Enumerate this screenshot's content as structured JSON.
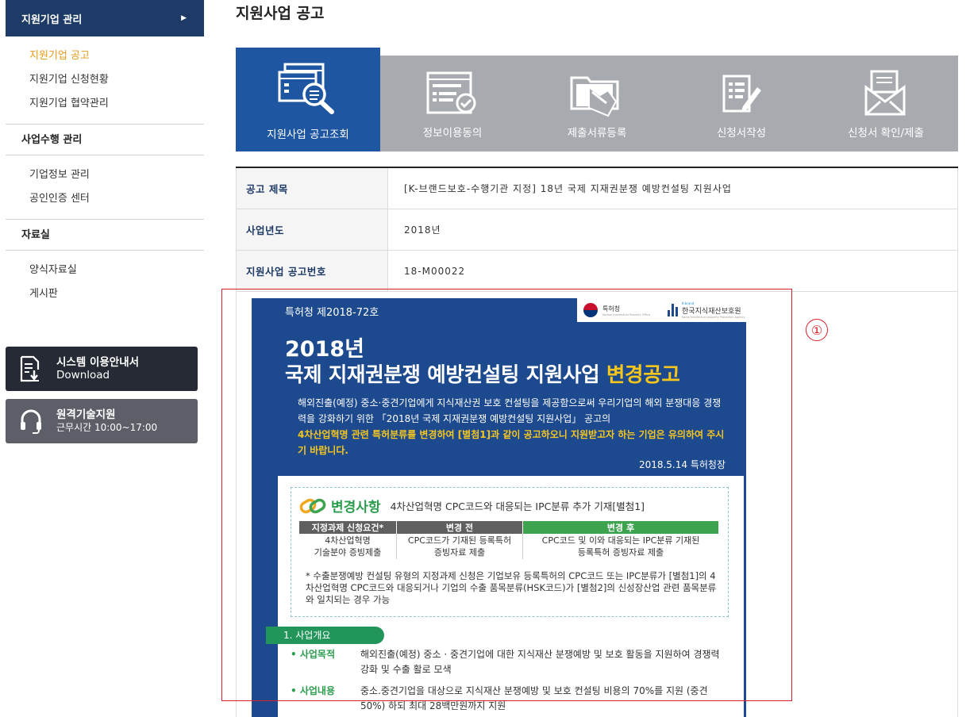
{
  "sidebar": {
    "head_label": "지원기업 관리",
    "sub_items": [
      {
        "label": "지원기업 공고",
        "active": true
      },
      {
        "label": "지원기업 신청현황",
        "active": false
      },
      {
        "label": "지원기업 협약관리",
        "active": false
      }
    ],
    "sections": [
      {
        "title": "사업수행 관리",
        "items": [
          "기업정보 관리",
          "공인인증 센터"
        ]
      },
      {
        "title": "자료실",
        "items": [
          "양식자료실",
          "게시판"
        ]
      }
    ],
    "download_btn": {
      "line1": "시스템 이용안내서",
      "line2": "Download"
    },
    "support_btn": {
      "line1": "원격기술지원",
      "line2": "근무시간 10:00~17:00"
    }
  },
  "page": {
    "title": "지원사업 공고"
  },
  "steps": [
    {
      "label": "지원사업 공고조회",
      "active": true,
      "icon": "search-document-icon"
    },
    {
      "label": "정보이용동의",
      "active": false,
      "icon": "checklist-icon"
    },
    {
      "label": "제출서류등록",
      "active": false,
      "icon": "document-upload-icon"
    },
    {
      "label": "신청서작성",
      "active": false,
      "icon": "write-form-icon"
    },
    {
      "label": "신청서 확인/제출",
      "active": false,
      "icon": "envelope-icon"
    }
  ],
  "info": [
    {
      "key": "공고 제목",
      "value": "[K-브랜드보호-수행기관 지정] 18년 국제 지재권분쟁 예방컨설팅 지원사업"
    },
    {
      "key": "사업년도",
      "value": "2018년"
    },
    {
      "key": "지원사업 공고번호",
      "value": "18-M00022"
    }
  ],
  "poster": {
    "notice_no": "특허청 제2018-72호",
    "logo1": {
      "name": "특허청",
      "sub": "Korean Intellectual Property Office"
    },
    "logo2": {
      "top": "K-brand",
      "name": "한국지식재산보호원",
      "sub": "Korea Intellectual property Protection Agency"
    },
    "year": "2018년",
    "title_main": "국제 지재권분쟁 예방컨설팅 지원사업 ",
    "title_highlight": "변경공고",
    "body_plain": "해외진출(예정) 중소·중견기업에게 지식재산권 보호 컨설팅을 제공함으로써 우리기업의 해외 분쟁대응 경쟁력을 강화하기 위한 「2018년 국제 지재권분쟁 예방컨설팅 지원사업」 공고의",
    "body_highlight": "4차산업혁명 관련 특허분류를 변경하여 [별첨1]과 같이 공고하오니 지원받고자 하는 기업은 유의하여 주시기 바랍니다.",
    "date": "2018.5.14 특허청장",
    "change_title": "변경사항",
    "change_desc": "4차산업혁명 CPC코드와 대응되는 IPC분류 추가 기재[별첨1]",
    "table_headers": [
      "지정과제 신청요건*",
      "변경 전",
      "변경 후"
    ],
    "table_row": [
      "4차산업혁명\n기술분야 증빙제출",
      "CPC코드가 기재된 등록특허\n증빙자료 제출",
      "CPC코드 및 이와 대응되는 IPC분류 기재된\n등록특허 증빙자료 제출"
    ],
    "note": "* 수출분쟁예방 컨설팅 유형의 지정과제 신청은 기업보유 등록특허의 CPC코드 또는 IPC분류가 [별첨1]의 4차산업혁명 CPC코드와 대응되거나 기업의 수출 품목분류(HSK코드)가 [별첨2]의 신성장산업 관련 품목분류와 일치되는 경우 가능",
    "section1": "1. 사업개요",
    "bullets": [
      {
        "key": "• 사업목적",
        "value": "해외진출(예정) 중소 · 중견기업에 대한 지식재산 분쟁예방 및 보호 활동을 지원하여 경쟁력 강화 및 수출 활로 모색"
      },
      {
        "key": "• 사업내용",
        "value": "중소.중견기업을 대상으로 지식재산 분쟁예방 및 보호 컨설팅 비용의 70%를 지원 (중견 50%) 하되 최대 28백만원까지 지원"
      }
    ]
  },
  "annotation": {
    "number": "①"
  },
  "colors": {
    "sidebar_head": "#1e3a66",
    "active_menu": "#e89a1a",
    "step_active": "#1e56a1",
    "step_inactive": "#a7abb0",
    "poster_bg": "#1d4a8e",
    "highlight_yellow": "#f7c61d",
    "annotation_red": "#d9202a"
  }
}
